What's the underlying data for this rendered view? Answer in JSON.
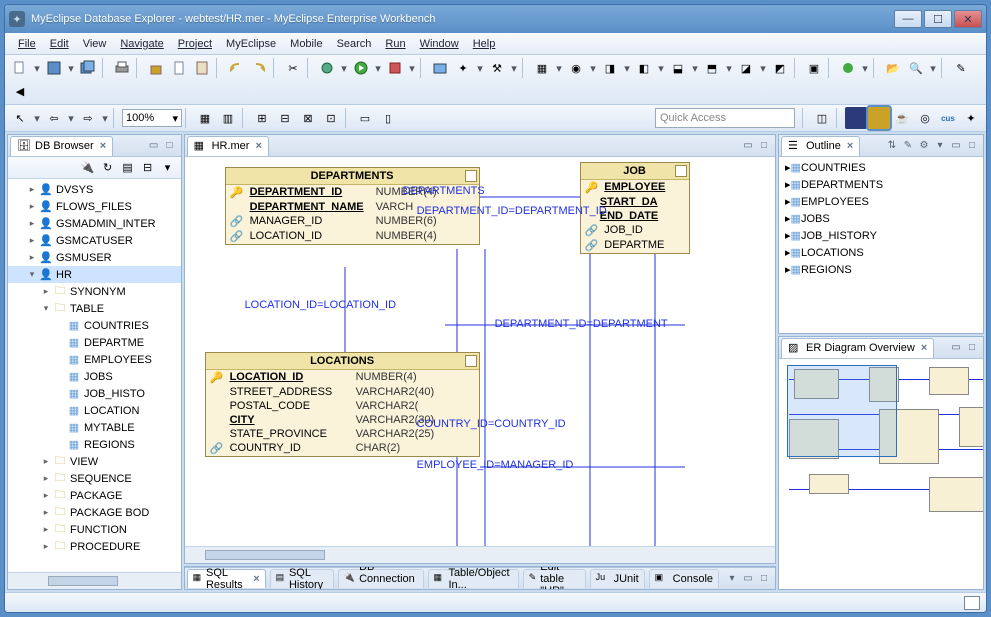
{
  "window": {
    "title": "MyEclipse Database Explorer - webtest/HR.mer - MyEclipse Enterprise Workbench"
  },
  "menu": [
    "File",
    "Edit",
    "View",
    "Navigate",
    "Project",
    "MyEclipse",
    "Mobile",
    "Search",
    "Run",
    "Window",
    "Help"
  ],
  "zoom": "100%",
  "quick_access_placeholder": "Quick Access",
  "left": {
    "tab": "DB Browser",
    "tree": [
      {
        "d": 1,
        "t": "user",
        "label": "DVSYS"
      },
      {
        "d": 1,
        "t": "user",
        "label": "FLOWS_FILES"
      },
      {
        "d": 1,
        "t": "user",
        "label": "GSMADMIN_INTER"
      },
      {
        "d": 1,
        "t": "user",
        "label": "GSMCATUSER"
      },
      {
        "d": 1,
        "t": "user",
        "label": "GSMUSER"
      },
      {
        "d": 1,
        "t": "usersel",
        "label": "HR",
        "exp": true,
        "sel": true
      },
      {
        "d": 2,
        "t": "fold",
        "label": "SYNONYM"
      },
      {
        "d": 2,
        "t": "fold",
        "label": "TABLE",
        "exp": true
      },
      {
        "d": 3,
        "t": "tbl",
        "label": "COUNTRIES"
      },
      {
        "d": 3,
        "t": "tbl",
        "label": "DEPARTME"
      },
      {
        "d": 3,
        "t": "tbl",
        "label": "EMPLOYEES"
      },
      {
        "d": 3,
        "t": "tbl",
        "label": "JOBS"
      },
      {
        "d": 3,
        "t": "tbl",
        "label": "JOB_HISTO"
      },
      {
        "d": 3,
        "t": "tbl",
        "label": "LOCATION"
      },
      {
        "d": 3,
        "t": "tbl",
        "label": "MYTABLE"
      },
      {
        "d": 3,
        "t": "tbl",
        "label": "REGIONS"
      },
      {
        "d": 2,
        "t": "fold",
        "label": "VIEW"
      },
      {
        "d": 2,
        "t": "fold",
        "label": "SEQUENCE"
      },
      {
        "d": 2,
        "t": "fold",
        "label": "PACKAGE"
      },
      {
        "d": 2,
        "t": "fold",
        "label": "PACKAGE BOD"
      },
      {
        "d": 2,
        "t": "fold",
        "label": "FUNCTION"
      },
      {
        "d": 2,
        "t": "fold",
        "label": "PROCEDURE"
      }
    ]
  },
  "editor": {
    "tab": "HR.mer",
    "tables": {
      "departments": {
        "title": "DEPARTMENTS",
        "cols": [
          {
            "pk": true,
            "fk": false,
            "name": "DEPARTMENT_ID",
            "type": "NUMBER(4)"
          },
          {
            "pk": false,
            "fk": false,
            "name": "DEPARTMENT_NAME",
            "type": "VARCH",
            "b": true
          },
          {
            "pk": false,
            "fk": true,
            "name": "MANAGER_ID",
            "type": "NUMBER(6)"
          },
          {
            "pk": false,
            "fk": true,
            "name": "LOCATION_ID",
            "type": "NUMBER(4)"
          }
        ]
      },
      "job_history": {
        "title": "JOB",
        "cols": [
          {
            "pk": true,
            "fk": true,
            "name": "EMPLOYEE",
            "type": ""
          },
          {
            "pk": false,
            "fk": false,
            "name": "START_DA",
            "type": "",
            "b": true
          },
          {
            "pk": false,
            "fk": false,
            "name": "END_DATE",
            "type": "",
            "b": true
          },
          {
            "pk": false,
            "fk": true,
            "name": "JOB_ID",
            "type": ""
          },
          {
            "pk": false,
            "fk": true,
            "name": "DEPARTME",
            "type": ""
          }
        ]
      },
      "locations": {
        "title": "LOCATIONS",
        "cols": [
          {
            "pk": true,
            "fk": false,
            "name": "LOCATION_ID",
            "type": "NUMBER(4)"
          },
          {
            "pk": false,
            "fk": false,
            "name": "STREET_ADDRESS",
            "type": "VARCHAR2(40)"
          },
          {
            "pk": false,
            "fk": false,
            "name": "POSTAL_CODE",
            "type": "VARCHAR2("
          },
          {
            "pk": false,
            "fk": false,
            "name": "CITY",
            "type": "VARCHAR2(30)",
            "b": true
          },
          {
            "pk": false,
            "fk": false,
            "name": "STATE_PROVINCE",
            "type": "VARCHAR2(25)"
          },
          {
            "pk": false,
            "fk": true,
            "name": "COUNTRY_ID",
            "type": "CHAR(2)"
          }
        ]
      }
    },
    "relations": {
      "r1": "DEPARTMENTS",
      "r2": "DEPARTMENT_ID=DEPARTMENT_ID",
      "r3": "LOCATION_ID=LOCATION_ID",
      "r4": "DEPARTMENT_ID=DEPARTMENT",
      "r5": "COUNTRY_ID=COUNTRY_ID",
      "r6": "EMPLOYEE_ID=MANAGER_ID"
    }
  },
  "outline": {
    "tab": "Outline",
    "items": [
      "COUNTRIES",
      "DEPARTMENTS",
      "EMPLOYEES",
      "JOBS",
      "JOB_HISTORY",
      "LOCATIONS",
      "REGIONS"
    ]
  },
  "overview": {
    "tab": "ER Diagram Overview"
  },
  "bottom": {
    "tabs": [
      "SQL Results",
      "SQL History",
      "DB Connection ...",
      "Table/Object In...",
      "Edit table \"HR\"...",
      "JUnit",
      "Console"
    ]
  }
}
